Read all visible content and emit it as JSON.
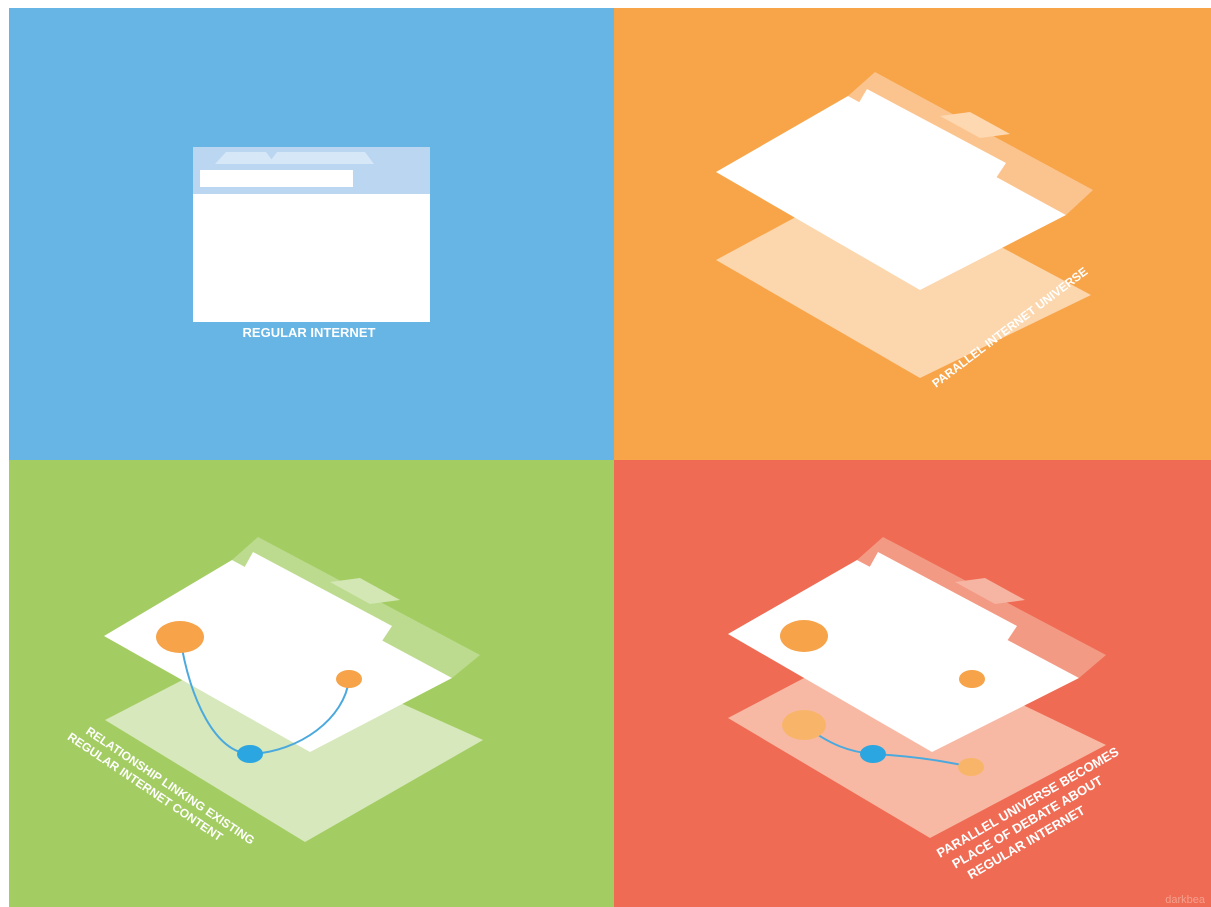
{
  "panels": [
    {
      "id": "regular-internet",
      "caption": "REGULAR INTERNET",
      "background": "#66B5E4"
    },
    {
      "id": "parallel-universe",
      "caption": "PARALLEL INTERNET UNIVERSE",
      "background": "#F8A54A"
    },
    {
      "id": "relationship-linking",
      "caption_lines": [
        "RELATIONSHIP LINKING EXISTING",
        "REGULAR INTERNET CONTENT"
      ],
      "background": "#A3CD63"
    },
    {
      "id": "place-of-debate",
      "caption_lines": [
        "PARALLEL UNIVERSE BECOMES",
        "PLACE OF DEBATE ABOUT",
        "REGULAR INTERNET"
      ],
      "background": "#EF6B54"
    }
  ],
  "watermark": "darkbea",
  "colors": {
    "node_orange": "#F6A34A",
    "node_blue": "#2CA6E0",
    "node_light_orange": "#F8B56A",
    "page_white": "#FFFFFF"
  }
}
